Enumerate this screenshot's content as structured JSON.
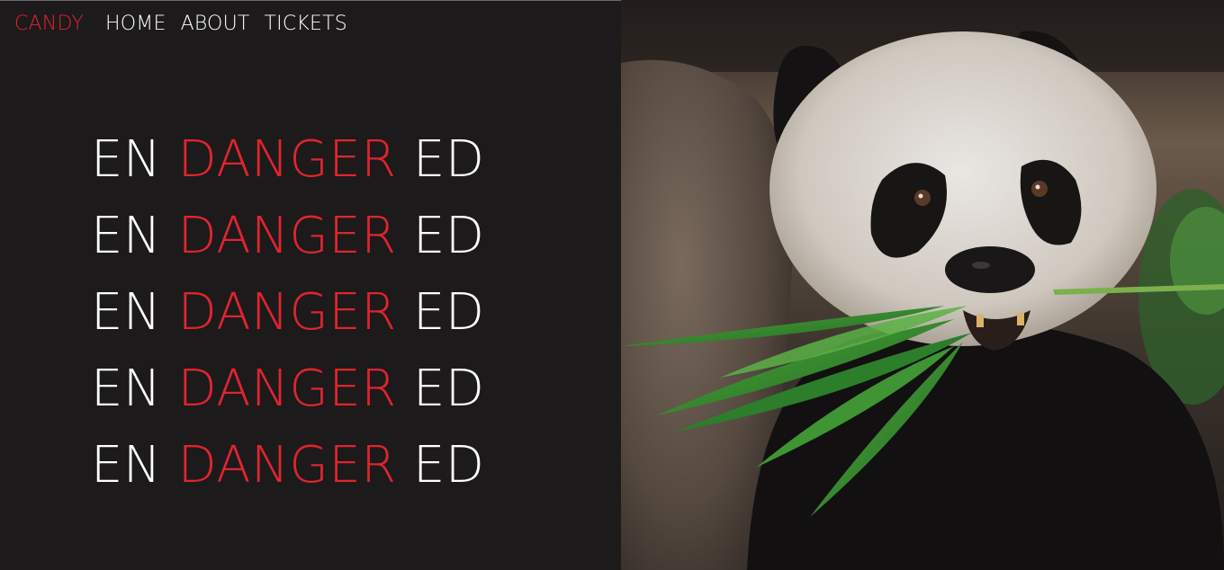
{
  "nav": {
    "brand": "CANDY",
    "links": [
      "HOME",
      "ABOUT",
      "TICKETS"
    ]
  },
  "hero_text": {
    "lines": [
      {
        "a": "EN",
        "b": "DANGER",
        "c": "ED"
      },
      {
        "a": "EN",
        "b": "DANGER",
        "c": "ED"
      },
      {
        "a": "EN",
        "b": "DANGER",
        "c": "ED"
      },
      {
        "a": "EN",
        "b": "DANGER",
        "c": "ED"
      },
      {
        "a": "EN",
        "b": "DANGER",
        "c": "ED"
      }
    ]
  },
  "colors": {
    "background": "#1c1a1b",
    "accent": "#e0242e",
    "text": "#ffffff"
  }
}
